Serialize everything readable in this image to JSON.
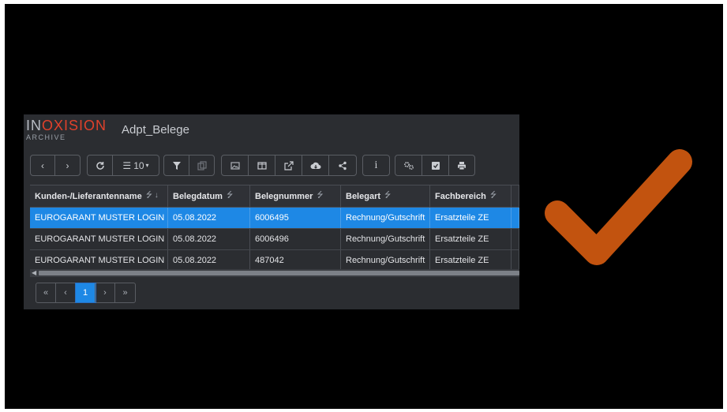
{
  "brand": {
    "logo_text_pre": "IN",
    "logo_text_accent": "OXISION",
    "logo_sub": "ARCHIVE"
  },
  "app": {
    "title": "Adpt_Belege"
  },
  "toolbar": {
    "page_size": "10"
  },
  "table": {
    "columns": [
      {
        "label": "Kunden-/Lieferantenname"
      },
      {
        "label": "Belegdatum"
      },
      {
        "label": "Belegnummer"
      },
      {
        "label": "Belegart"
      },
      {
        "label": "Fachbereich"
      }
    ],
    "rows": [
      {
        "name": "EUROGARANT MUSTER LOGIN",
        "date": "05.08.2022",
        "number": "6006495",
        "type": "Rechnung/Gutschrift",
        "area": "Ersatzteile ZE",
        "selected": true
      },
      {
        "name": "EUROGARANT MUSTER LOGIN",
        "date": "05.08.2022",
        "number": "6006496",
        "type": "Rechnung/Gutschrift",
        "area": "Ersatzteile ZE",
        "selected": false
      },
      {
        "name": "EUROGARANT MUSTER LOGIN",
        "date": "05.08.2022",
        "number": "487042",
        "type": "Rechnung/Gutschrift",
        "area": "Ersatzteile ZE",
        "selected": false
      }
    ]
  },
  "pager": {
    "first": "«",
    "prev": "‹",
    "current": "1",
    "next": "›",
    "last": "»"
  },
  "colors": {
    "selection": "#1e88e5",
    "logo_accent": "#e0412b",
    "checkmark": "#c2530f"
  }
}
